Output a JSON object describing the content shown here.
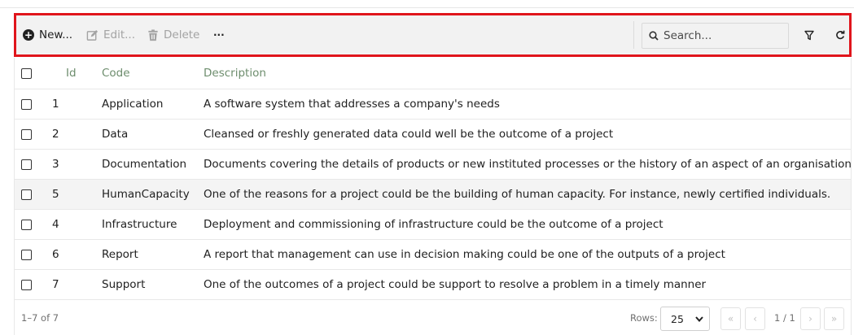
{
  "toolbar": {
    "new_label": "New...",
    "edit_label": "Edit...",
    "delete_label": "Delete",
    "more_label": "···",
    "search_placeholder": "Search..."
  },
  "table": {
    "columns": {
      "id": "Id",
      "code": "Code",
      "description": "Description"
    },
    "rows": [
      {
        "id": "1",
        "code": "Application",
        "description": "A software system that addresses a company's needs"
      },
      {
        "id": "2",
        "code": "Data",
        "description": "Cleansed or freshly generated data could well be the outcome of a project"
      },
      {
        "id": "3",
        "code": "Documentation",
        "description": "Documents covering the details of products or new instituted processes or the history of an aspect of an organisation"
      },
      {
        "id": "5",
        "code": "HumanCapacity",
        "description": "One of the reasons for a project could be the building of human capacity. For instance, newly certified individuals."
      },
      {
        "id": "4",
        "code": "Infrastructure",
        "description": "Deployment and commissioning of infrastructure could be the outcome of a project"
      },
      {
        "id": "6",
        "code": "Report",
        "description": "A report that management can use in decision making could be one of the outputs of a project"
      },
      {
        "id": "7",
        "code": "Support",
        "description": "One of the outcomes of a project could be support to resolve a problem in a timely manner"
      }
    ]
  },
  "footer": {
    "count": "1–7 of 7",
    "rows_label": "Rows:",
    "rows_value": "25",
    "page_label": "1 / 1",
    "first": "«",
    "prev": "‹",
    "next": "›",
    "last": "»"
  },
  "colors": {
    "highlight_border": "#e0151c",
    "header_text": "#6d8d6d",
    "selected_row": "#f4f4f4"
  }
}
